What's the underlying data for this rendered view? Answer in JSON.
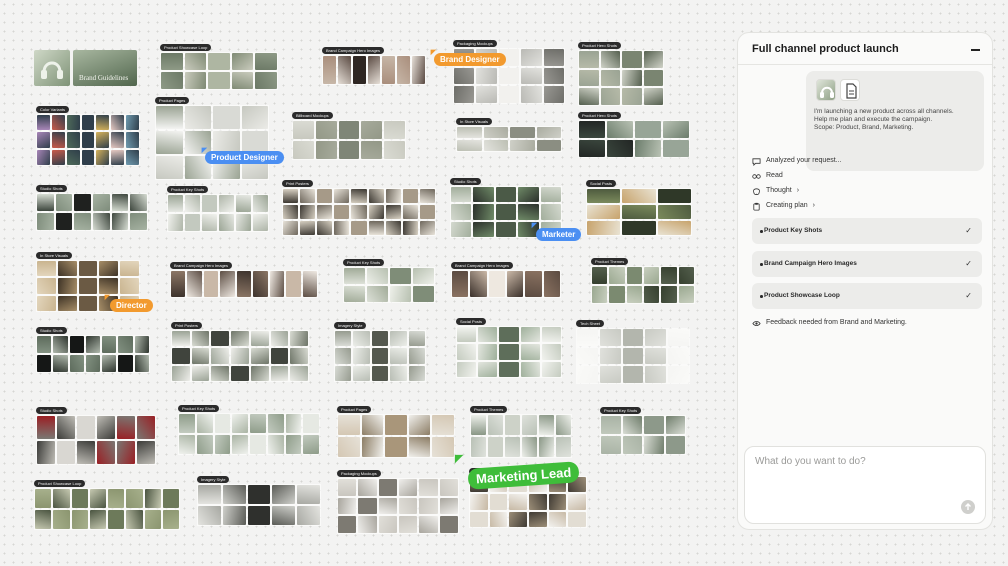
{
  "canvas": {
    "hero": {
      "label": "Brand Guidelines"
    },
    "boards": [
      {
        "label": "Product Showcase Loop",
        "cols": 5,
        "rows": 2,
        "palette": [
          "#8e9a86",
          "#aeb6a2",
          "#6c7966",
          "#c9cbbd",
          "#7f8a74"
        ]
      },
      {
        "label": "Brand Campaign Hero Images",
        "cols": 7,
        "rows": 1,
        "palette": [
          "#5a4a42",
          "#c7b7a8",
          "#2f2723",
          "#a98e7c",
          "#e6dfd7"
        ]
      },
      {
        "label": "Packaging Mockups",
        "cols": 5,
        "rows": 3,
        "palette": [
          "#e2e2de",
          "#b9b9b4",
          "#6d6d68",
          "#f2f1ee",
          "#999893"
        ]
      },
      {
        "label": "Product Hero Shots",
        "cols": 4,
        "rows": 3,
        "palette": [
          "#9aa393",
          "#d0d3c8",
          "#55604f",
          "#b6baa8",
          "#7a8571"
        ]
      },
      {
        "label": "Color Variants",
        "cols": 7,
        "rows": 3,
        "palette": [
          "#c95b4a",
          "#6f9bb0",
          "#d5b25b",
          "#4f6b5a",
          "#a886b8",
          "#e6c9c2",
          "#2f3e4a"
        ]
      },
      {
        "label": "Product Pages",
        "cols": 4,
        "rows": 3,
        "palette": [
          "#f4f4f2",
          "#d9dad5",
          "#9aa393",
          "#ebebe7",
          "#c6c8c0"
        ]
      },
      {
        "label": "Billboard Mockups",
        "cols": 5,
        "rows": 2,
        "palette": [
          "#a7ab9c",
          "#c8c9bf",
          "#7f8677",
          "#dadbd3",
          "#939887"
        ]
      },
      {
        "label": "In Store Visuals",
        "cols": 4,
        "rows": 2,
        "palette": [
          "#cfd0c8",
          "#a9ab9f",
          "#e4e4df",
          "#8b8e82",
          "#bcbfb3"
        ]
      },
      {
        "label": "Product Hero Shots",
        "cols": 4,
        "rows": 2,
        "palette": [
          "#222624",
          "#6b7c6b",
          "#b9c2b4",
          "#3a463d",
          "#98a597"
        ]
      },
      {
        "label": "Studio Shots",
        "cols": 6,
        "rows": 2,
        "palette": [
          "#1f211f",
          "#d6dcd2",
          "#7e8c7b",
          "#a7b3a3",
          "#3d463d"
        ]
      },
      {
        "label": "Product Key Shots",
        "cols": 6,
        "rows": 2,
        "palette": [
          "#e7e9e4",
          "#c3c9bf",
          "#9ba595",
          "#f1f2ee",
          "#aeb5a8"
        ]
      },
      {
        "label": "Print Posters",
        "cols": 9,
        "rows": 3,
        "palette": [
          "#e9e4da",
          "#3c3832",
          "#a69a88",
          "#d6cfc1",
          "#6e675c"
        ]
      },
      {
        "label": "Studio Shots",
        "cols": 5,
        "rows": 3,
        "palette": [
          "#2b302b",
          "#6f8a67",
          "#d4d9cf",
          "#4b5a47",
          "#a2ae9c"
        ]
      },
      {
        "label": "Social Posts",
        "cols": 3,
        "rows": 3,
        "palette": [
          "#4e5b3f",
          "#c7a36c",
          "#e9e3d3",
          "#7b8a5c",
          "#2f3828"
        ]
      },
      {
        "label": "In Store Visuals",
        "cols": 5,
        "rows": 3,
        "palette": [
          "#6b5a44",
          "#c9b48f",
          "#3e3326",
          "#a78e68",
          "#e3d6bd"
        ]
      },
      {
        "label": "Brand Campaign Hero Images",
        "cols": 9,
        "rows": 1,
        "palette": [
          "#3d332d",
          "#c9b8a7",
          "#8b7665",
          "#efe9e2",
          "#5d4e44"
        ]
      },
      {
        "label": "Product Key Shots",
        "cols": 4,
        "rows": 2,
        "palette": [
          "#b7c0b0",
          "#dde1d8",
          "#7f8d78",
          "#a1ab98",
          "#eef0ea"
        ]
      },
      {
        "label": "Brand Campaign Hero Images",
        "cols": 6,
        "rows": 1,
        "palette": [
          "#3a302a",
          "#cbb9a8",
          "#8a7261",
          "#eee8e0",
          "#5b4b41"
        ]
      },
      {
        "label": "Product Themes",
        "cols": 6,
        "rows": 2,
        "palette": [
          "#545f4d",
          "#9aa890",
          "#c8cfbf",
          "#36402f",
          "#7b8a70"
        ]
      },
      {
        "label": "Studio Shots",
        "cols": 7,
        "rows": 2,
        "palette": [
          "#151716",
          "#5d6b5c",
          "#b0b9ad",
          "#2e352e",
          "#839282"
        ]
      },
      {
        "label": "Print Posters",
        "cols": 7,
        "rows": 3,
        "palette": [
          "#eeeeea",
          "#40443d",
          "#9ba396",
          "#d8dbd2",
          "#6e7568"
        ]
      },
      {
        "label": "Imagery Style",
        "cols": 5,
        "rows": 3,
        "palette": [
          "#b8bdb4",
          "#d8dbd5",
          "#54584f",
          "#969b8f",
          "#eceee9"
        ]
      },
      {
        "label": "Social Posts",
        "cols": 5,
        "rows": 3,
        "palette": [
          "#e3e6df",
          "#9fb09b",
          "#c4cbbf",
          "#5e6e5a",
          "#f2f3ef"
        ]
      },
      {
        "label": "Tech Sheet",
        "cols": 5,
        "rows": 3,
        "palette": [
          "#f5f5f3",
          "#e0e1dc",
          "#c8cac3",
          "#fafaf8",
          "#b3b6ad"
        ]
      },
      {
        "label": "Studio Shots",
        "cols": 6,
        "rows": 2,
        "palette": [
          "#d9d7d2",
          "#9a1f24",
          "#3b3b38",
          "#bfbdb6",
          "#7a7873"
        ]
      },
      {
        "label": "Product Key Shots",
        "cols": 8,
        "rows": 2,
        "palette": [
          "#c3cbc0",
          "#e6e9e3",
          "#8e9c89",
          "#aab4a4",
          "#f0f2ee"
        ]
      },
      {
        "label": "Product Pages",
        "cols": 5,
        "rows": 2,
        "palette": [
          "#f1f0ec",
          "#d4c7b3",
          "#a9967a",
          "#e6e1d7",
          "#8c7d65"
        ]
      },
      {
        "label": "Product Themes",
        "cols": 6,
        "rows": 2,
        "palette": [
          "#b9c1b6",
          "#dfe2dc",
          "#8a9786",
          "#cdd2c8",
          "#eef0eb"
        ]
      },
      {
        "label": "Product Key Shots",
        "cols": 4,
        "rows": 2,
        "palette": [
          "#a9b3a5",
          "#d9ddd5",
          "#6f7d6b",
          "#c0c8bb",
          "#8d998a"
        ]
      },
      {
        "label": "Product Showcase Loop",
        "cols": 8,
        "rows": 2,
        "palette": [
          "#6d7a5a",
          "#a7b08c",
          "#4a5440",
          "#c6c9b1",
          "#8b956f"
        ]
      },
      {
        "label": "Imagery Style",
        "cols": 5,
        "rows": 2,
        "palette": [
          "#e4e4e0",
          "#2f302d",
          "#a7a8a2",
          "#cfd0cb",
          "#5a5b56"
        ]
      },
      {
        "label": "Packaging Mockups",
        "cols": 6,
        "rows": 3,
        "palette": [
          "#f0efec",
          "#c9c6bf",
          "#7d7a72",
          "#e1dfd9",
          "#a8a59d"
        ]
      },
      {
        "label": "Product Pages",
        "cols": 6,
        "rows": 3,
        "palette": [
          "#f3f2ef",
          "#c7b9a5",
          "#3f3a33",
          "#e2ddd3",
          "#9c8e78"
        ]
      }
    ],
    "collaborators": [
      {
        "name": "Brand Designer",
        "color": "#f29a2e"
      },
      {
        "name": "Product Designer",
        "color": "#4b8ff2"
      },
      {
        "name": "Marketer",
        "color": "#4b8ff2"
      },
      {
        "name": "Director",
        "color": "#f29a2e"
      },
      {
        "name": "Marketing Lead",
        "color": "#3fbd3a"
      }
    ]
  },
  "panel": {
    "title": "Full channel product launch",
    "message": "I'm launching a new product across all channels.\nHelp me plan and execute the campaign.\nScope: Product, Brand, Marketing.",
    "status": {
      "analyzed": "Analyzed your request...",
      "read": "Read",
      "thought": "Thought",
      "thought_chevron": "›",
      "creating": "Creating plan",
      "creating_chevron": "›"
    },
    "tasks": [
      {
        "label": "Product Key Shots",
        "check": "✓"
      },
      {
        "label": "Brand Campaign Hero Images",
        "check": "✓"
      },
      {
        "label": "Product Showcase Loop",
        "check": "✓"
      }
    ],
    "feedback": "Feedback needed from Brand and Marketing.",
    "input": {
      "placeholder": "What do you want to do?"
    }
  }
}
